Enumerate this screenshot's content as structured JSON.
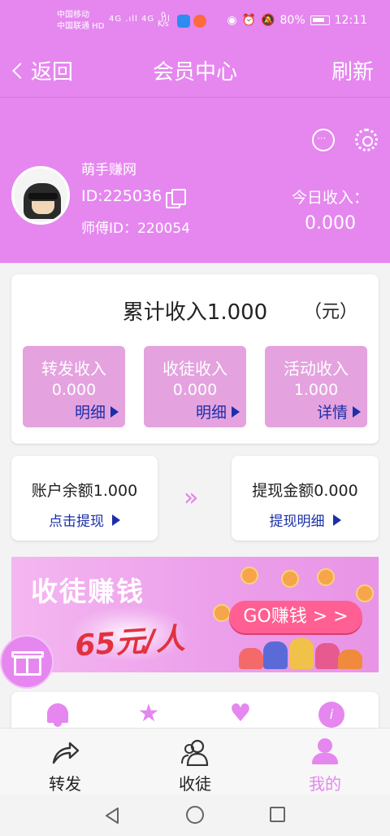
{
  "status_bar": {
    "carrier_1": "中国移动",
    "carrier_2": "中国联通 HD",
    "signal": "4G .ıll 4G .ıll",
    "speed_value": "0",
    "speed_unit": "K/s",
    "battery": "80%",
    "time": "12:11"
  },
  "nav": {
    "back_label": "返回",
    "title": "会员中心",
    "refresh_label": "刷新"
  },
  "profile": {
    "username": "萌手赚网",
    "user_id": "ID:225036",
    "master_id": "师傅ID：220054",
    "today_income_label": "今日收入：",
    "today_income_value": "0.000"
  },
  "summary": {
    "total_income": "累计收入1.000",
    "unit": "（元）",
    "stats": [
      {
        "label": "转发收入",
        "value": "0.000",
        "link": "明细"
      },
      {
        "label": "收徒收入",
        "value": "0.000",
        "link": "明细"
      },
      {
        "label": "活动收入",
        "value": "1.000",
        "link": "详情"
      }
    ]
  },
  "balance": {
    "account_balance": "账户余额1.000",
    "withdraw_link": "点击提现",
    "withdraw_amount": "提现金额0.000",
    "withdraw_detail_link": "提现明细",
    "arrow": "»"
  },
  "banner": {
    "title": "收徒赚钱",
    "amount": "65元/人",
    "cta": "GO赚钱 > >"
  },
  "features": {
    "star_glyph": "★",
    "heart_glyph": "♥",
    "info_glyph": "i"
  },
  "tabs": [
    {
      "label": "转发",
      "icon": "share-icon",
      "active": false
    },
    {
      "label": "收徒",
      "icon": "people-icon",
      "active": false
    },
    {
      "label": "我的",
      "icon": "person-icon",
      "active": true
    }
  ],
  "colors": {
    "primary": "#e587ef",
    "stat_tile": "#e4a2df",
    "link_blue": "#1b2fa8",
    "banner_amount_red": "#e1313f"
  }
}
